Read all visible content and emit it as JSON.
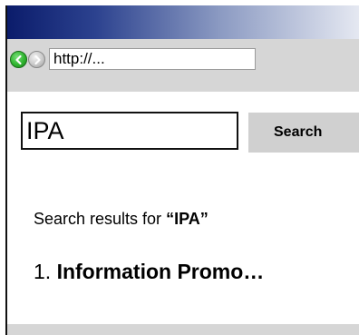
{
  "browser": {
    "address": "http://..."
  },
  "search": {
    "query": "IPA",
    "button_label": "Search"
  },
  "results": {
    "heading_prefix": "Search results for ",
    "heading_query": "“IPA”",
    "items": [
      {
        "number": "1. ",
        "title": "Information Promo…"
      }
    ]
  },
  "colors": {
    "titlebar_dark": "#0b1c6b",
    "toolbar": "#d6d6d6",
    "button": "#d0d0d0",
    "back_button": "#2fb52f"
  },
  "icons": {
    "back": "back-arrow-icon",
    "forward": "forward-arrow-icon"
  }
}
